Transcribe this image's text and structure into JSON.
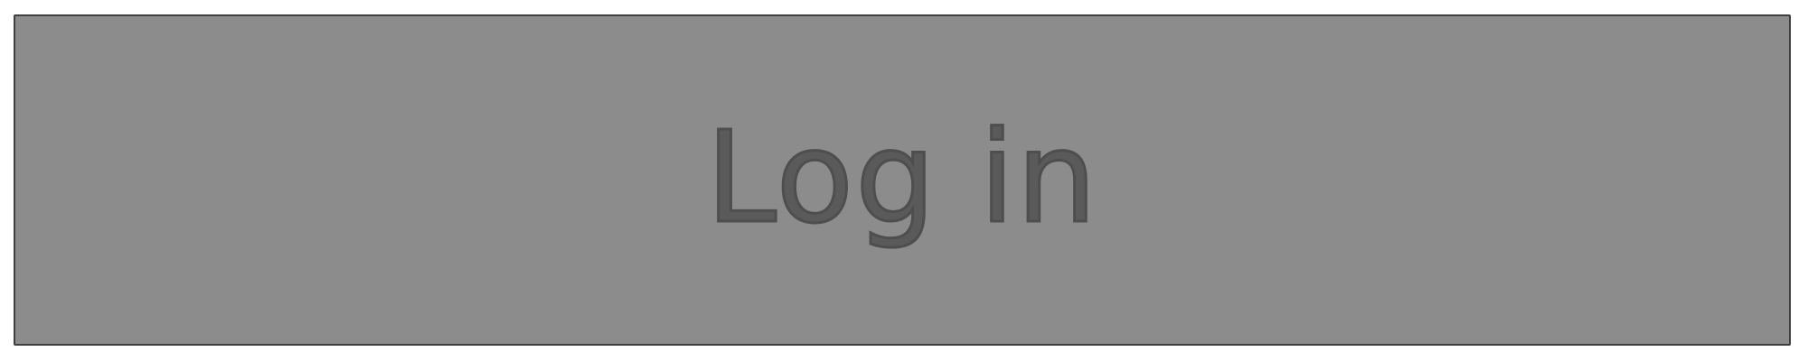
{
  "login_button": {
    "label": "Log in"
  },
  "colors": {
    "button_background": "#8c8c8c",
    "button_border": "#3f3f3f",
    "label_color": "#5a5a5a",
    "page_background": "#ffffff"
  }
}
